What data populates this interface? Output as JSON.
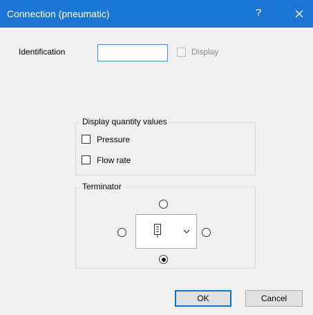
{
  "window": {
    "title": "Connection (pneumatic)",
    "help_glyph": "?",
    "close_icon": "close-icon"
  },
  "identification": {
    "label": "Identification",
    "value": "",
    "display_label": "Display",
    "display_checked": false,
    "display_enabled": false
  },
  "quantity_group": {
    "title": "Display quantity values",
    "items": [
      {
        "label": "Pressure",
        "checked": false
      },
      {
        "label": "Flow rate",
        "checked": false
      }
    ]
  },
  "terminator_group": {
    "title": "Terminator",
    "selected_position": "bottom",
    "symbol_icon": "pneumatic-terminator-icon",
    "dropdown_icon": "chevron-down-icon"
  },
  "buttons": {
    "ok": "OK",
    "cancel": "Cancel"
  },
  "colors": {
    "titlebar": "#1a76d2",
    "dialog_bg": "#f0f0f0",
    "focus_border": "#3c8ad8"
  }
}
